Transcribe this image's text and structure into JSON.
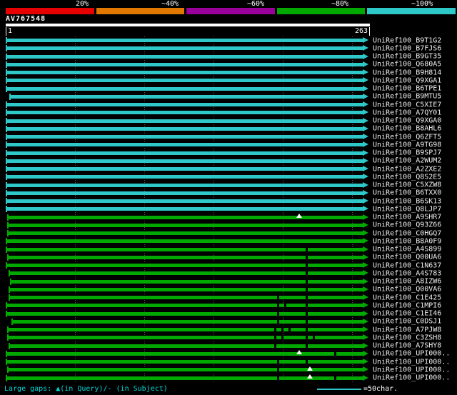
{
  "query": {
    "id": "AV767548",
    "start": 1,
    "end": 263
  },
  "scale": {
    "labels": [
      "20%",
      "~40%",
      "~60%",
      "~80%",
      "~100%"
    ],
    "colors": [
      "#e60000",
      "#e07800",
      "#990099",
      "#00a800",
      "#2fc8c8"
    ]
  },
  "colors": {
    "cyan": "#2fc8c8",
    "green": "#00a800",
    "background": "#000000",
    "marker": "#ffffff"
  },
  "legend": {
    "gaps_text": "Large gaps: ▲(in Query)/- (in Subject)",
    "ruler_text": "=50char."
  },
  "chart_data": {
    "type": "bar",
    "title": "AV767548",
    "xlim": [
      1,
      263
    ],
    "ruler_chars": 50,
    "identity_buckets": [
      "20%",
      "~40%",
      "~60%",
      "~80%",
      "~100%"
    ],
    "rows": [
      {
        "label": "UniRef100_B9T1G2",
        "identity": "~100%",
        "color": "cyan",
        "start": 0,
        "markers": []
      },
      {
        "label": "UniRef100_B7FJS6",
        "identity": "~100%",
        "color": "cyan",
        "start": 0,
        "markers": []
      },
      {
        "label": "UniRef100_B9GT35",
        "identity": "~100%",
        "color": "cyan",
        "start": 0,
        "markers": []
      },
      {
        "label": "UniRef100_Q680A5",
        "identity": "~100%",
        "color": "cyan",
        "start": 0,
        "markers": []
      },
      {
        "label": "UniRef100_B9H814",
        "identity": "~100%",
        "color": "cyan",
        "start": 0,
        "markers": []
      },
      {
        "label": "UniRef100_Q9XGA1",
        "identity": "~100%",
        "color": "cyan",
        "start": 0,
        "markers": []
      },
      {
        "label": "UniRef100_B6TPE1",
        "identity": "~100%",
        "color": "cyan",
        "start": 0,
        "markers": []
      },
      {
        "label": "UniRef100_B9MTU5",
        "identity": "~100%",
        "color": "cyan",
        "start": 5,
        "markers": []
      },
      {
        "label": "UniRef100_C5XIE7",
        "identity": "~100%",
        "color": "cyan",
        "start": 0,
        "markers": []
      },
      {
        "label": "UniRef100_A7QY01",
        "identity": "~100%",
        "color": "cyan",
        "start": 0,
        "markers": []
      },
      {
        "label": "UniRef100_Q9XGA0",
        "identity": "~100%",
        "color": "cyan",
        "start": 0,
        "markers": []
      },
      {
        "label": "UniRef100_B8AHL6",
        "identity": "~100%",
        "color": "cyan",
        "start": 0,
        "markers": []
      },
      {
        "label": "UniRef100_Q6ZFT5",
        "identity": "~100%",
        "color": "cyan",
        "start": 0,
        "markers": []
      },
      {
        "label": "UniRef100_A9TG98",
        "identity": "~100%",
        "color": "cyan",
        "start": 0,
        "markers": []
      },
      {
        "label": "UniRef100_B9SPJ7",
        "identity": "~100%",
        "color": "cyan",
        "start": 0,
        "markers": []
      },
      {
        "label": "UniRef100_A2WUM2",
        "identity": "~100%",
        "color": "cyan",
        "start": 0,
        "markers": []
      },
      {
        "label": "UniRef100_A2ZXE2",
        "identity": "~100%",
        "color": "cyan",
        "start": 0,
        "markers": []
      },
      {
        "label": "UniRef100_Q8S2E5",
        "identity": "~100%",
        "color": "cyan",
        "start": 0,
        "markers": []
      },
      {
        "label": "UniRef100_C5XZW8",
        "identity": "~100%",
        "color": "cyan",
        "start": 0,
        "markers": []
      },
      {
        "label": "UniRef100_B6TXX0",
        "identity": "~100%",
        "color": "cyan",
        "start": 0,
        "markers": []
      },
      {
        "label": "UniRef100_B6SK13",
        "identity": "~100%",
        "color": "cyan",
        "start": 0,
        "markers": []
      },
      {
        "label": "UniRef100_Q8LJP7",
        "identity": "~100%",
        "color": "cyan",
        "start": 0,
        "markers": []
      },
      {
        "label": "UniRef100_A9SHR7",
        "identity": "~80%",
        "color": "green",
        "start": 2,
        "markers": [
          {
            "pos": 0.802,
            "type": "gap_query"
          }
        ]
      },
      {
        "label": "UniRef100_Q93Z66",
        "identity": "~80%",
        "color": "green",
        "start": 2,
        "markers": []
      },
      {
        "label": "UniRef100_C0HGQ7",
        "identity": "~80%",
        "color": "green",
        "start": 2,
        "markers": []
      },
      {
        "label": "UniRef100_B8A0F9",
        "identity": "~80%",
        "color": "green",
        "start": 0,
        "markers": []
      },
      {
        "label": "UniRef100_A4S899",
        "identity": "~80%",
        "color": "green",
        "start": 0,
        "markers": [
          {
            "pos": 0.827,
            "type": "gap_subject"
          }
        ]
      },
      {
        "label": "UniRef100_Q00UA6",
        "identity": "~80%",
        "color": "green",
        "start": 2,
        "markers": [
          {
            "pos": 0.827,
            "type": "gap_subject"
          }
        ]
      },
      {
        "label": "UniRef100_C1N637",
        "identity": "~80%",
        "color": "green",
        "start": 0,
        "markers": [
          {
            "pos": 0.827,
            "type": "gap_subject"
          }
        ]
      },
      {
        "label": "UniRef100_A4S783",
        "identity": "~80%",
        "color": "green",
        "start": 4,
        "markers": [
          {
            "pos": 0.827,
            "type": "gap_subject"
          }
        ]
      },
      {
        "label": "UniRef100_A8IZW6",
        "identity": "~80%",
        "color": "green",
        "start": 6,
        "markers": [
          {
            "pos": 0.827,
            "type": "gap_subject"
          }
        ]
      },
      {
        "label": "UniRef100_Q00VA6",
        "identity": "~80%",
        "color": "green",
        "start": 4,
        "markers": [
          {
            "pos": 0.827,
            "type": "gap_subject"
          }
        ]
      },
      {
        "label": "UniRef100_C1E425",
        "identity": "~80%",
        "color": "green",
        "start": 4,
        "markers": [
          {
            "pos": 0.749,
            "type": "gap_subject"
          },
          {
            "pos": 0.827,
            "type": "gap_subject"
          }
        ]
      },
      {
        "label": "UniRef100_C1MPI6",
        "identity": "~80%",
        "color": "green",
        "start": 0,
        "markers": [
          {
            "pos": 0.749,
            "type": "gap_subject"
          },
          {
            "pos": 0.769,
            "type": "gap_subject"
          },
          {
            "pos": 0.827,
            "type": "gap_subject"
          }
        ]
      },
      {
        "label": "UniRef100_C1EI46",
        "identity": "~80%",
        "color": "green",
        "start": 0,
        "markers": [
          {
            "pos": 0.749,
            "type": "gap_subject"
          },
          {
            "pos": 0.827,
            "type": "gap_subject"
          }
        ]
      },
      {
        "label": "UniRef100_C0DSJ1",
        "identity": "~80%",
        "color": "green",
        "start": 8,
        "markers": [
          {
            "pos": 0.749,
            "type": "gap_subject"
          },
          {
            "pos": 0.827,
            "type": "gap_subject"
          }
        ]
      },
      {
        "label": "UniRef100_A7PJW8",
        "identity": "~80%",
        "color": "green",
        "start": 2,
        "markers": [
          {
            "pos": 0.741,
            "type": "gap_subject"
          },
          {
            "pos": 0.761,
            "type": "gap_subject"
          },
          {
            "pos": 0.781,
            "type": "gap_subject"
          },
          {
            "pos": 0.827,
            "type": "gap_subject"
          }
        ]
      },
      {
        "label": "UniRef100_C3ZSH8",
        "identity": "~80%",
        "color": "green",
        "start": 2,
        "markers": [
          {
            "pos": 0.741,
            "type": "gap_subject"
          },
          {
            "pos": 0.761,
            "type": "gap_subject"
          },
          {
            "pos": 0.827,
            "type": "gap_subject"
          },
          {
            "pos": 0.847,
            "type": "gap_subject"
          }
        ]
      },
      {
        "label": "UniRef100_A7SHY8",
        "identity": "~80%",
        "color": "green",
        "start": 4,
        "markers": [
          {
            "pos": 0.741,
            "type": "gap_subject"
          },
          {
            "pos": 0.827,
            "type": "gap_subject"
          }
        ]
      },
      {
        "label": "UniRef100_UPI000..",
        "identity": "~80%",
        "color": "green",
        "start": 0,
        "markers": [
          {
            "pos": 0.802,
            "type": "gap_query"
          },
          {
            "pos": 0.906,
            "type": "gap_subject"
          }
        ]
      },
      {
        "label": "UniRef100_UPI000..",
        "identity": "~80%",
        "color": "green",
        "start": 0,
        "markers": [
          {
            "pos": 0.749,
            "type": "gap_subject"
          },
          {
            "pos": 0.827,
            "type": "gap_subject"
          }
        ]
      },
      {
        "label": "UniRef100_UPI000..",
        "identity": "~80%",
        "color": "green",
        "start": 2,
        "markers": [
          {
            "pos": 0.749,
            "type": "gap_subject"
          },
          {
            "pos": 0.831,
            "type": "gap_query"
          }
        ]
      },
      {
        "label": "UniRef100_UPI000..",
        "identity": "~80%",
        "color": "green",
        "start": 0,
        "markers": [
          {
            "pos": 0.749,
            "type": "gap_subject"
          },
          {
            "pos": 0.831,
            "type": "gap_query"
          },
          {
            "pos": 0.906,
            "type": "gap_subject"
          }
        ]
      }
    ]
  }
}
